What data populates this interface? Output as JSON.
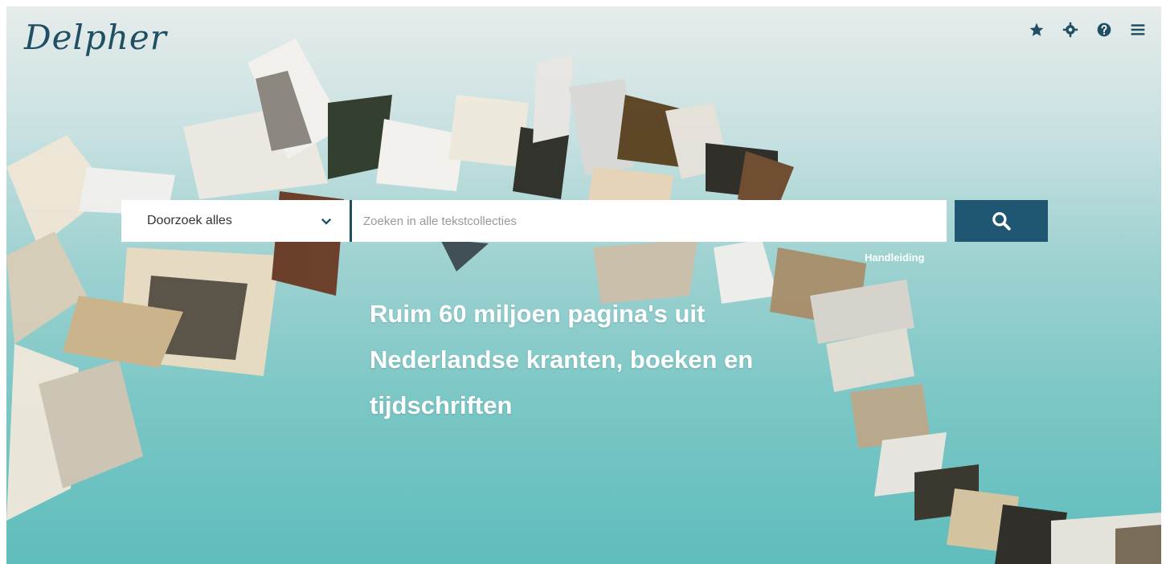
{
  "header": {
    "logo": "Delpher",
    "icons": [
      "star-icon",
      "gear-icon",
      "help-icon",
      "menu-icon"
    ]
  },
  "search": {
    "scope_label": "Doorzoek alles",
    "placeholder": "Zoeken in alle tekstcollecties",
    "help_link": "Handleiding"
  },
  "hero": {
    "headline": "Ruim 60 miljoen pagina's uit Nederlandse kranten, boeken en tijdschriften"
  },
  "colors": {
    "brand": "#1f4f63",
    "button": "#1f5672",
    "teal": "#5fbdbc"
  }
}
